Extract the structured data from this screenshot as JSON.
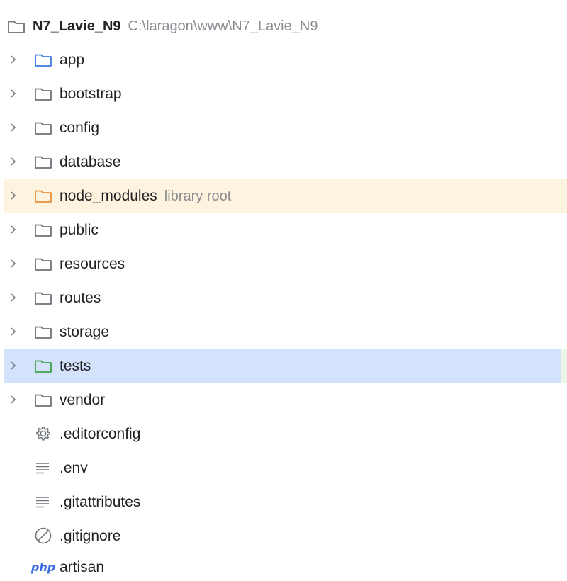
{
  "colors": {
    "folder_default": "#6f737a",
    "folder_blue": "#3d7bdc",
    "folder_orange": "#e8913a",
    "folder_green": "#3fa24b",
    "library_row_bg": "#fdf3de",
    "selected_row_bg": "#d5e2fb"
  },
  "root": {
    "name": "N7_Lavie_N9",
    "path": "C:\\laragon\\www\\N7_Lavie_N9",
    "icon": "folder-icon"
  },
  "folders": [
    {
      "name": "app",
      "icon": "folder-blue-icon"
    },
    {
      "name": "bootstrap",
      "icon": "folder-icon"
    },
    {
      "name": "config",
      "icon": "folder-icon"
    },
    {
      "name": "database",
      "icon": "folder-icon"
    },
    {
      "name": "node_modules",
      "hint": "library root",
      "icon": "folder-orange-icon"
    },
    {
      "name": "public",
      "icon": "folder-icon"
    },
    {
      "name": "resources",
      "icon": "folder-icon"
    },
    {
      "name": "routes",
      "icon": "folder-icon"
    },
    {
      "name": "storage",
      "icon": "folder-icon"
    },
    {
      "name": "tests",
      "icon": "folder-green-icon",
      "selected": true
    },
    {
      "name": "vendor",
      "icon": "folder-icon"
    }
  ],
  "files": [
    {
      "name": ".editorconfig",
      "icon": "gear-icon"
    },
    {
      "name": ".env",
      "icon": "text-lines-icon"
    },
    {
      "name": ".gitattributes",
      "icon": "text-lines-icon"
    },
    {
      "name": ".gitignore",
      "icon": "ignore-icon"
    },
    {
      "name": "artisan",
      "icon": "php-icon",
      "icon_text": "php"
    }
  ]
}
